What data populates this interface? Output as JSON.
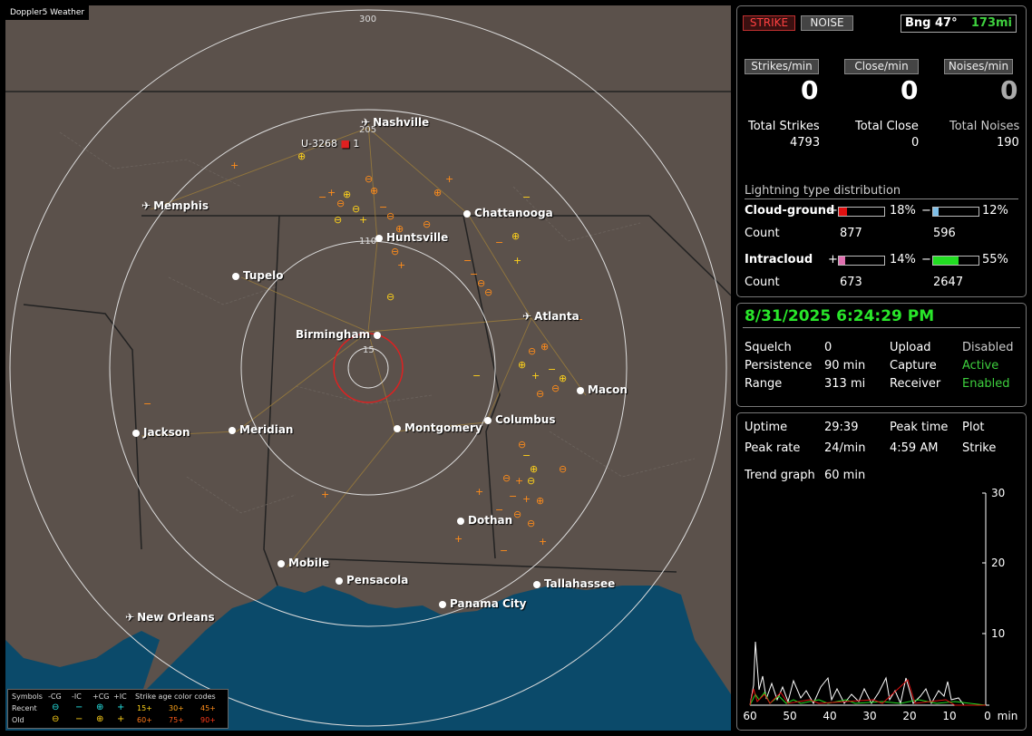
{
  "app": {
    "title": "Doppler5 Weather"
  },
  "map": {
    "rings": [
      "300",
      "205",
      "110",
      "15"
    ],
    "cities": [
      {
        "name": "Nashville",
        "kind": "airport",
        "label_key": "0"
      },
      {
        "name": "Memphis",
        "kind": "airport"
      },
      {
        "name": "Chattanooga",
        "kind": "city"
      },
      {
        "name": "Huntsville",
        "kind": "city"
      },
      {
        "name": "Tupelo",
        "kind": "city"
      },
      {
        "name": "Atlanta",
        "kind": "airport"
      },
      {
        "name": "Birmingham",
        "kind": "city"
      },
      {
        "name": "Macon",
        "kind": "city"
      },
      {
        "name": "Jackson",
        "kind": "city"
      },
      {
        "name": "Meridian",
        "kind": "city"
      },
      {
        "name": "Montgomery",
        "kind": "city"
      },
      {
        "name": "Columbus",
        "kind": "city"
      },
      {
        "name": "Dothan",
        "kind": "city"
      },
      {
        "name": "Mobile",
        "kind": "city"
      },
      {
        "name": "Pensacola",
        "kind": "city"
      },
      {
        "name": "Tallahassee",
        "kind": "city"
      },
      {
        "name": "Panama City",
        "kind": "city"
      },
      {
        "name": "New Orleans",
        "kind": "airport"
      }
    ],
    "track_label": "U-3268",
    "track_count": "1"
  },
  "legend": {
    "symbols": "Symbols",
    "neg_cg": "-CG",
    "neg_ic": "-IC",
    "pos_cg": "+CG",
    "pos_ic": "+IC",
    "age_title": "Strike age color codes",
    "recent": "Recent",
    "old": "Old",
    "ages": [
      "15+",
      "30+",
      "45+",
      "60+",
      "75+",
      "90+"
    ]
  },
  "top": {
    "strike_btn": "STRIKE",
    "noise_btn": "NOISE",
    "bearing": "Bng 47°",
    "distance": "173mi",
    "strikes_min_btn": "Strikes/min",
    "close_min_btn": "Close/min",
    "noises_min_btn": "Noises/min",
    "strikes_min": "0",
    "close_min": "0",
    "noises_min": "0",
    "total_strikes_lbl": "Total Strikes",
    "total_close_lbl": "Total Close",
    "total_noises_lbl": "Total Noises",
    "total_strikes": "4793",
    "total_close": "0",
    "total_noises": "190",
    "dist_title": "Lightning type distribution",
    "cg_label": "Cloud-ground",
    "ic_label": "Intracloud",
    "count_label": "Count",
    "plus": "+",
    "minus": "−",
    "cg_pos_pct": "18%",
    "cg_neg_pct": "12%",
    "cg_pos_count": "877",
    "cg_neg_count": "596",
    "ic_pos_pct": "14%",
    "ic_neg_pct": "55%",
    "ic_pos_count": "673",
    "ic_neg_count": "2647",
    "cg_pos_frac": 0.18,
    "cg_neg_frac": 0.12,
    "ic_pos_frac": 0.14,
    "ic_neg_frac": 0.55,
    "colors": {
      "cg_pos": "#e01010",
      "cg_neg": "#7fbfe8",
      "ic_pos": "#e070b0",
      "ic_neg": "#22dd22"
    }
  },
  "status": {
    "datetime": "8/31/2025 6:24:29 PM",
    "squelch_lbl": "Squelch",
    "squelch": "0",
    "upload_lbl": "Upload",
    "upload": "Disabled",
    "persistence_lbl": "Persistence",
    "persistence": "90 min",
    "capture_lbl": "Capture",
    "capture": "Active",
    "range_lbl": "Range",
    "range": "313 mi",
    "receiver_lbl": "Receiver",
    "receiver": "Enabled"
  },
  "trend": {
    "uptime_lbl": "Uptime",
    "uptime": "29:39",
    "peak_time_lbl": "Peak time",
    "plot_lbl": "Plot",
    "peak_rate_lbl": "Peak rate",
    "peak_rate": "24/min",
    "peak_time": "4:59 AM",
    "plot": "Strike",
    "trend_lbl": "Trend graph",
    "trend": "60 min",
    "x_ticks": [
      "60",
      "50",
      "40",
      "30",
      "20",
      "10",
      "0"
    ],
    "x_unit": "min",
    "y_ticks": [
      "30",
      "20",
      "10"
    ]
  }
}
